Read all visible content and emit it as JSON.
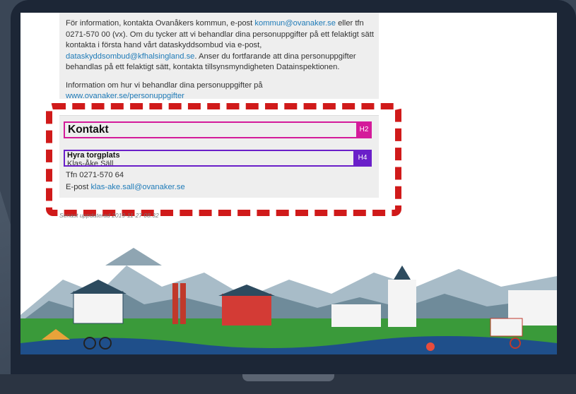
{
  "info": {
    "para1_prefix": "För information, kontakta Ovanåkers kommun, e-post ",
    "para1_email": "kommun@ovanaker.se",
    "para1_mid": " eller tfn 0271-570 00 (vx). Om du tycker att vi behandlar dina personuppgifter på ett felaktigt sätt kontakta i första hand vårt dataskyddsombud via e-post, ",
    "para1_email2": "dataskyddsombud@kfhalsingland.se",
    "para1_suffix": ". Anser du fortfarande att dina personuppgifter behandlas på ett felaktigt sätt, kontakta tillsynsmyndigheten Datainspektionen.",
    "para2_prefix": "Information om hur vi behandlar dina personuppgifter på ",
    "para2_link": "www.ovanaker.se/personuppgifter"
  },
  "contact": {
    "heading": "Kontakt",
    "heading_badge": "H2",
    "subheading": "Hyra torgplats",
    "subheading_badge": "H4",
    "name": "Klas-Åke Säll",
    "phone_label": "Tfn 0271-570 64",
    "email_label": "E-post ",
    "email": "klas-ake.sall@ovanaker.se"
  },
  "updated": "Senast uppdaterad 2019-11-27 08.32",
  "colors": {
    "dashed_outline": "#d01a1a",
    "h2_badge": "#d41b9a",
    "h4_badge": "#6a1fc9",
    "link": "#1f7bb8"
  }
}
